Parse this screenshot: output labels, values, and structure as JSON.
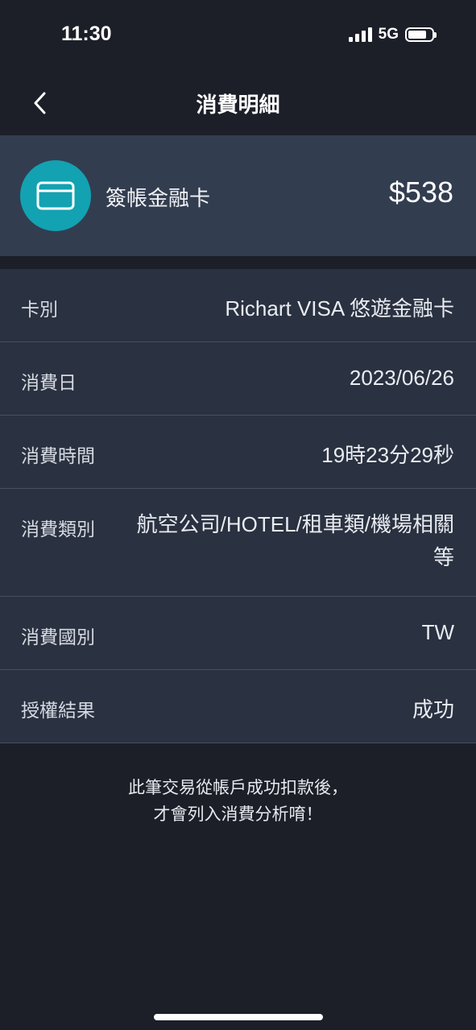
{
  "status": {
    "time": "11:30",
    "network": "5G",
    "icons": [
      "signal-icon",
      "battery-icon"
    ]
  },
  "nav": {
    "title": "消費明細",
    "back_icon": "chevron-left-icon"
  },
  "summary": {
    "icon": "credit-card-icon",
    "label": "簽帳金融卡",
    "amount": "$538",
    "accent": "#12a2b2"
  },
  "details": [
    {
      "label": "卡別",
      "value": "Richart VISA 悠遊金融卡"
    },
    {
      "label": "消費日",
      "value": "2023/06/26"
    },
    {
      "label": "消費時間",
      "value": "19時23分29秒"
    },
    {
      "label": "消費類別",
      "value": "航空公司/HOTEL/租車類/機場相關等"
    },
    {
      "label": "消費國別",
      "value": "TW"
    },
    {
      "label": "授權結果",
      "value": "成功"
    }
  ],
  "footer": {
    "line1": "此筆交易從帳戶成功扣款後，",
    "line2": "才會列入消費分析唷！"
  }
}
